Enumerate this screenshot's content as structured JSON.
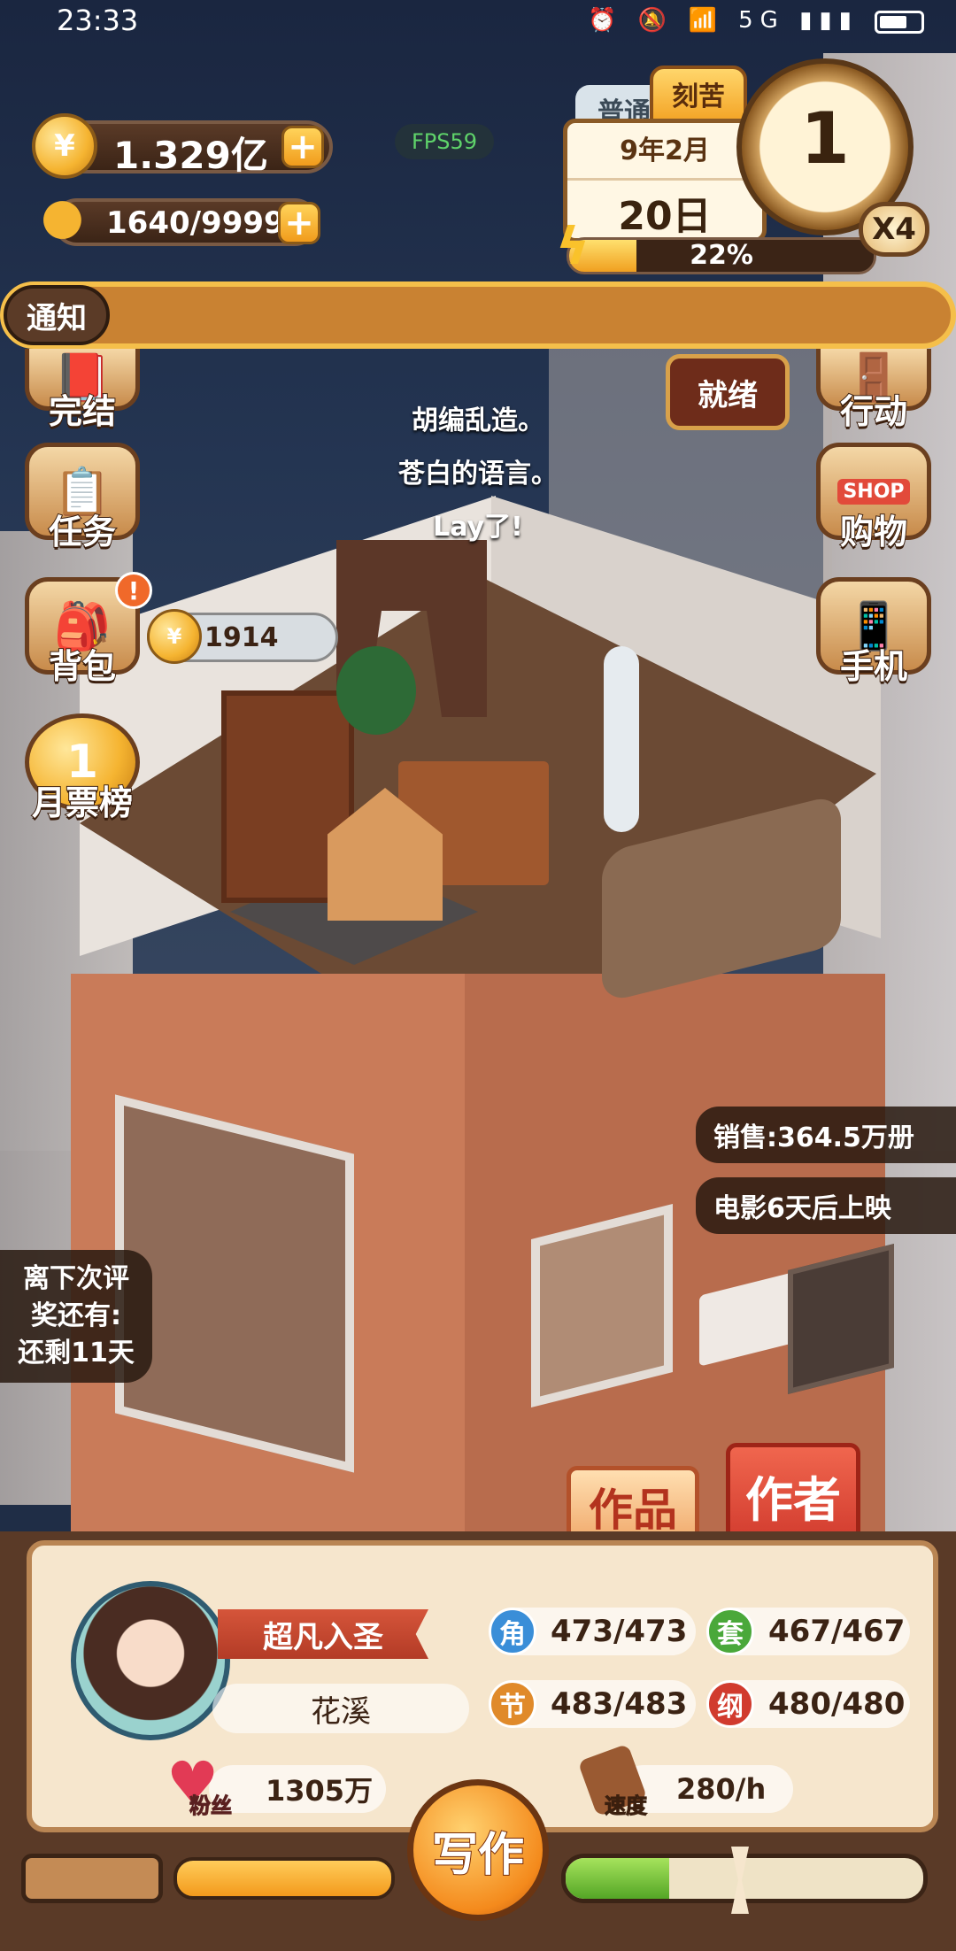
{
  "status_bar": {
    "time": "23:33",
    "icons": "⏰ 🔕 📶 5G ▮▮▮"
  },
  "resources": {
    "gold": {
      "icon": "coin-icon",
      "symbol": "¥",
      "value": "1.329亿"
    },
    "inspiration": {
      "icon": "bulb-icon",
      "value": "1640/9999"
    }
  },
  "fps": "FPS59",
  "mode_tabs": {
    "normal": "普通",
    "hard": "刻苦"
  },
  "date": {
    "year_month": "9年2月",
    "day": "20日"
  },
  "clock": {
    "value": "1",
    "speed": "X4"
  },
  "energy": {
    "percent_text": "22%",
    "fraction": 0.22
  },
  "notice": {
    "label": "通知",
    "text": ""
  },
  "left_menu": [
    {
      "label": "完结",
      "icon": "book-icon"
    },
    {
      "label": "任务",
      "icon": "clipboard-icon"
    },
    {
      "label": "背包",
      "icon": "backpack-icon",
      "badge": "!"
    },
    {
      "label": "月票榜",
      "icon": "medal-icon",
      "medal_number": "1"
    }
  ],
  "right_menu": [
    {
      "label": "行动",
      "icon": "door-icon"
    },
    {
      "label": "购物",
      "icon": "shop-icon",
      "sign": "SHOP"
    },
    {
      "label": "手机",
      "icon": "phone-icon"
    }
  ],
  "ready_button": "就绪",
  "coin_bubble": {
    "value": "1914"
  },
  "dialogue": [
    "胡编乱造。",
    "苍白的语言。",
    "Lay了!"
  ],
  "info": {
    "sales": "销售:364.5万册",
    "movie": "电影6天后上映"
  },
  "award_countdown": {
    "line1": "离下次评",
    "line2": "奖还有:",
    "line3": "还剩11天"
  },
  "tabs": {
    "works": "作品",
    "author": "作者"
  },
  "author": {
    "rank": "超凡入圣",
    "name": "花溪",
    "fans_label": "粉丝",
    "fans": "1305万",
    "speed_label": "速度",
    "speed": "280/h"
  },
  "stats": [
    {
      "key": "角",
      "value": "473/473",
      "color": "#3a8ed8"
    },
    {
      "key": "套",
      "value": "467/467",
      "color": "#4aa83a"
    },
    {
      "key": "节",
      "value": "483/483",
      "color": "#e08a2a"
    },
    {
      "key": "纲",
      "value": "480/480",
      "color": "#d13b2e"
    }
  ],
  "write_button": "写作",
  "writing_progress": {
    "fraction": 0.29
  }
}
